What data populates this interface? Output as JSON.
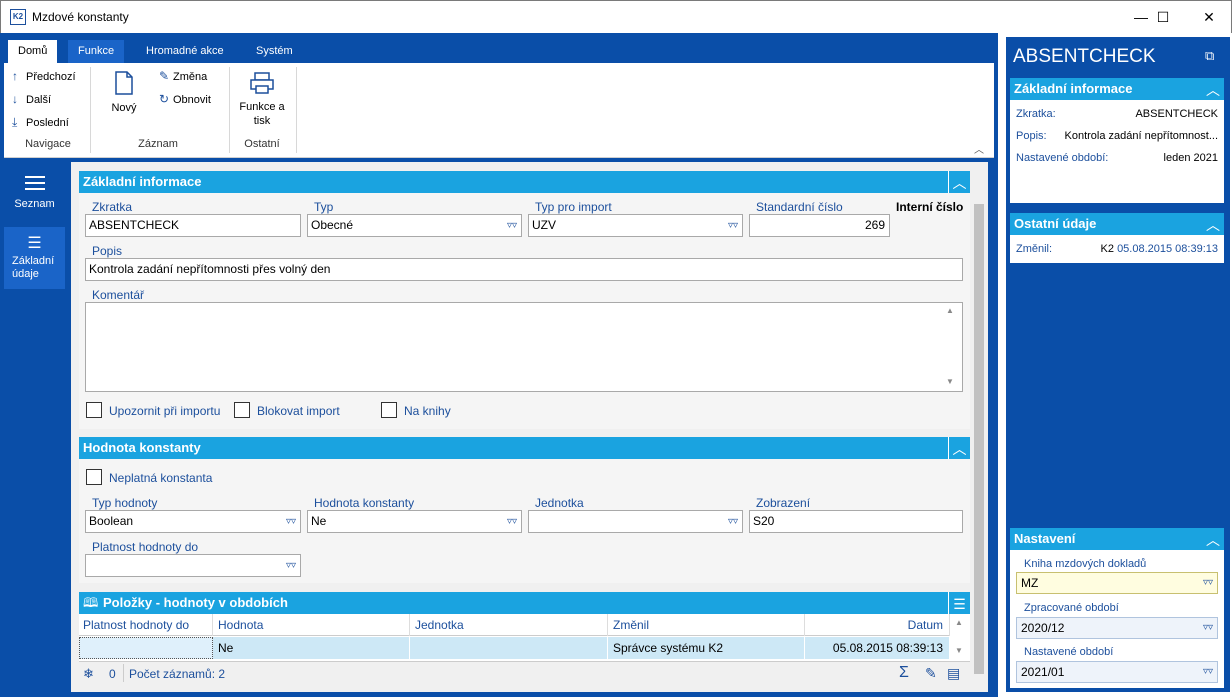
{
  "window": {
    "title": "Mzdové konstanty",
    "app_icon": "K2",
    "minimize": "—",
    "maximize": "☐",
    "close": "✕"
  },
  "ribbon": {
    "tabs": [
      "Domů",
      "Funkce",
      "Hromadné akce",
      "Systém"
    ],
    "navigace": {
      "label": "Navigace",
      "prev": "Předchozí",
      "next": "Další",
      "last": "Poslední"
    },
    "zaznam": {
      "label": "Záznam",
      "new": "Nový",
      "edit": "Změna",
      "refresh": "Obnovit"
    },
    "ostatni": {
      "label": "Ostatní",
      "print": "Funkce a tisk"
    }
  },
  "nav": {
    "seznam": "Seznam",
    "zakladni": "Základní údaje"
  },
  "zakladni": {
    "header": "Základní informace",
    "zkratka_label": "Zkratka",
    "zkratka": "ABSENTCHECK",
    "typ_label": "Typ",
    "typ": "Obecné",
    "typ_import_label": "Typ pro import",
    "typ_import": "UZV",
    "std_cislo_label": "Standardní číslo",
    "std_cislo": "269",
    "interni_label": "Interní číslo",
    "popis_label": "Popis",
    "popis": "Kontrola zadání nepřítomnosti přes volný den",
    "komentar_label": "Komentář",
    "komentar": "",
    "chk_upozornit": "Upozornit při importu",
    "chk_blokovat": "Blokovat import",
    "chk_knihy": "Na knihy"
  },
  "hodnota": {
    "header": "Hodnota konstanty",
    "neplatna": "Neplatná konstanta",
    "typ_hodnoty_label": "Typ hodnoty",
    "typ_hodnoty": "Boolean",
    "hodnota_label": "Hodnota konstanty",
    "hodnota": "Ne",
    "jednotka_label": "Jednotka",
    "jednotka": "",
    "zobrazeni_label": "Zobrazení",
    "zobrazeni": "S20",
    "platnost_label": "Platnost hodnoty do",
    "platnost": ""
  },
  "polozky": {
    "header": "Položky - hodnoty v obdobích",
    "columns": [
      "Platnost hodnoty do",
      "Hodnota",
      "Jednotka",
      "Změnil",
      "Datum"
    ],
    "rows": [
      [
        "",
        "Ne",
        "",
        "Správce systému K2",
        "05.08.2015 08:39:13"
      ]
    ],
    "footer_count": "0",
    "footer_records": "Počet záznamů: 2"
  },
  "right": {
    "title": "ABSENTCHECK",
    "zakladni_header": "Základní informace",
    "zkratka_k": "Zkratka:",
    "zkratka_v": "ABSENTCHECK",
    "popis_k": "Popis:",
    "popis_v": "Kontrola zadání nepřítomnost...",
    "obdobi_k": "Nastavené období:",
    "obdobi_v": "leden 2021",
    "ostatni_header": "Ostatní údaje",
    "zmenil_k": "Změnil:",
    "zmenil_user": "K2",
    "zmenil_date": "05.08.2015 08:39:13",
    "nastaveni_header": "Nastavení",
    "kniha_label": "Kniha mzdových dokladů",
    "kniha": "MZ",
    "zprac_label": "Zpracované období",
    "zprac": "2020/12",
    "nast_label": "Nastavené období",
    "nast": "2021/01"
  }
}
